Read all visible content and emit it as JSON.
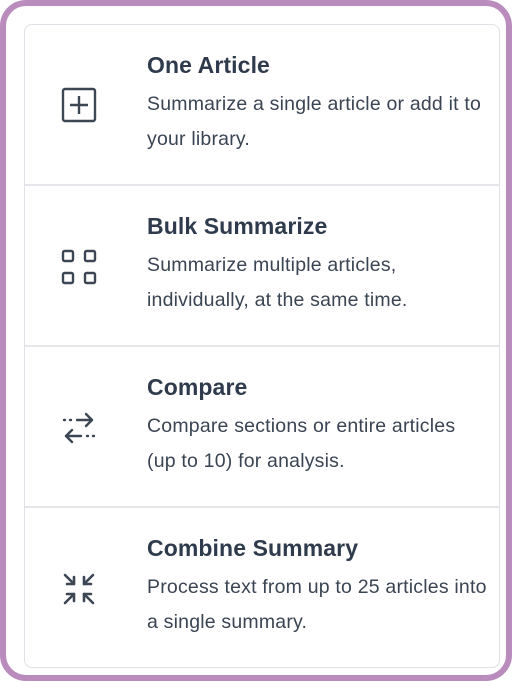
{
  "options": [
    {
      "title": "One Article",
      "description": "Summarize a single article or add it to your library.",
      "icon": "plus-square-icon"
    },
    {
      "title": "Bulk Summarize",
      "description": "Summarize multiple articles, individually, at the same time.",
      "icon": "grid-squares-icon"
    },
    {
      "title": "Compare",
      "description": "Compare sections or entire articles (up to 10) for analysis.",
      "icon": "compare-arrows-icon"
    },
    {
      "title": "Combine Summary",
      "description": "Process text from up to 25 articles into a single summary.",
      "icon": "combine-arrows-icon"
    }
  ],
  "colors": {
    "frame": "#b98cbd",
    "title": "#2f3b4c",
    "text": "#3a4452",
    "divider": "#e4e6ea"
  }
}
